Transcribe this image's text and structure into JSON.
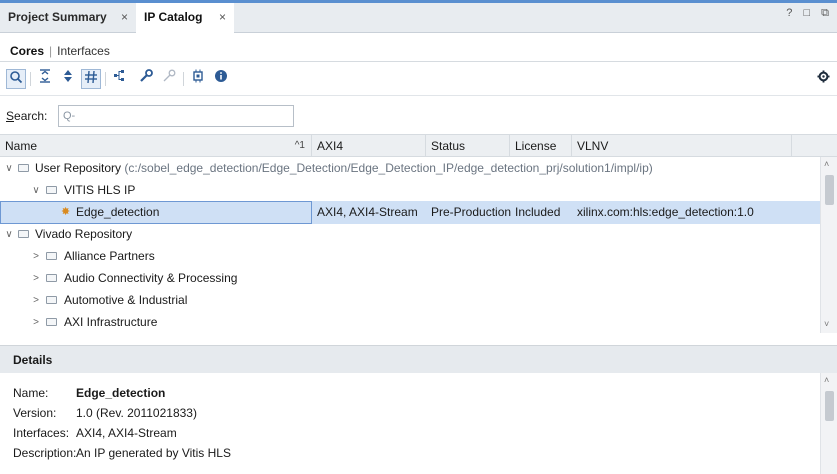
{
  "tabs": [
    {
      "label": "Project Summary",
      "close": "×"
    },
    {
      "label": "IP Catalog",
      "close": "×"
    }
  ],
  "window_controls": "? □ ⧉",
  "subtabs": {
    "active": "Cores",
    "sep": "|",
    "other": "Interfaces"
  },
  "toolbar": {
    "icons": [
      "search-icon",
      "collapse-all-icon",
      "expand-all-icon",
      "flatten-icon",
      "hierarchy-icon",
      "wrench-icon",
      "key-icon",
      "chip-icon",
      "info-icon"
    ],
    "settings_icon": "gear-icon"
  },
  "search": {
    "label_underlined": "S",
    "label_rest": "earch:",
    "placeholder": "Q-"
  },
  "columns": {
    "name": "Name",
    "sort_indicator": "^1",
    "axi4": "AXI4",
    "status": "Status",
    "license": "License",
    "vlnv": "VLNV"
  },
  "rows": [
    {
      "expander": "∨",
      "name": "User Repository",
      "path": "(c:/sobel_edge_detection/Edge_Detection/Edge_Detection_IP/edge_detection_prj/solution1/impl/ip)"
    },
    {
      "expander": "∨",
      "name": "VITIS HLS IP"
    },
    {
      "name": "Edge_detection",
      "axi4": "AXI4, AXI4-Stream",
      "status": "Pre-Production",
      "license": "Included",
      "vlnv": "xilinx.com:hls:edge_detection:1.0"
    },
    {
      "expander": "∨",
      "name": "Vivado Repository"
    },
    {
      "expander": ">",
      "name": "Alliance Partners"
    },
    {
      "expander": ">",
      "name": "Audio Connectivity & Processing"
    },
    {
      "expander": ">",
      "name": "Automotive & Industrial"
    },
    {
      "expander": ">",
      "name": "AXI Infrastructure"
    }
  ],
  "details": {
    "title": "Details",
    "name_key": "Name:",
    "name_val": "Edge_detection",
    "version_key": "Version:",
    "version_val": "1.0 (Rev. 2011021833)",
    "interfaces_key": "Interfaces:",
    "interfaces_val": "AXI4, AXI4-Stream",
    "description_key": "Description:",
    "description_val": "An IP generated by Vitis HLS"
  },
  "colors": {
    "selection": "#cfe0f5",
    "accent": "#2d5b95",
    "ip_icon": "#d98a1f"
  }
}
